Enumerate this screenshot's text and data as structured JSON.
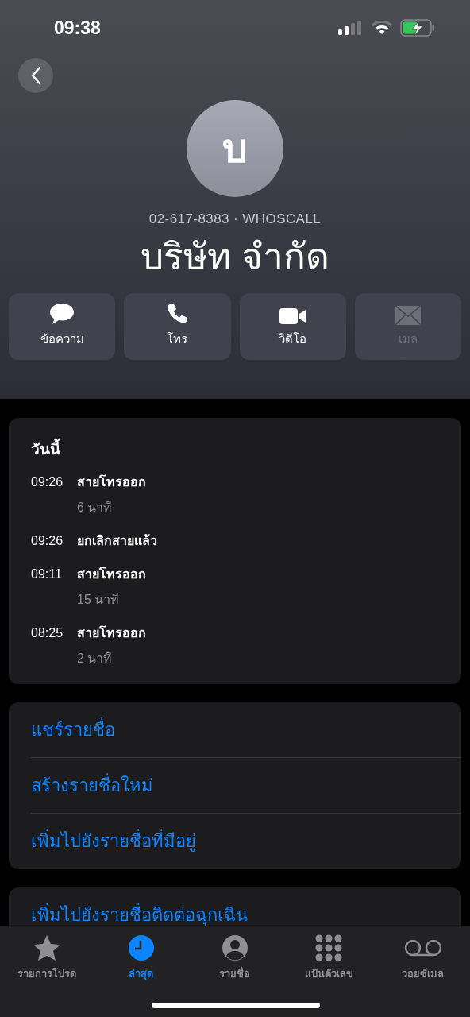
{
  "status_bar": {
    "time": "09:38"
  },
  "contact": {
    "initial": "บ",
    "subtitle": "02-617-8383 · WHOSCALL",
    "name": "บริษัท จำกัด"
  },
  "actions": [
    {
      "kind": "message",
      "label": "ข้อความ",
      "disabled": false
    },
    {
      "kind": "call",
      "label": "โทร",
      "disabled": false
    },
    {
      "kind": "video",
      "label": "วิดีโอ",
      "disabled": false
    },
    {
      "kind": "mail",
      "label": "เมล",
      "disabled": true
    }
  ],
  "call_history": {
    "heading": "วันนี้",
    "calls": [
      {
        "time": "09:26",
        "type": "สายโทรออก",
        "duration": "6 นาที"
      },
      {
        "time": "09:26",
        "type": "ยกเลิกสายแล้ว"
      },
      {
        "time": "09:11",
        "type": "สายโทรออก",
        "duration": "15 นาที"
      },
      {
        "time": "08:25",
        "type": "สายโทรออก",
        "duration": "2 นาที"
      }
    ]
  },
  "options": [
    "แชร์รายชื่อ",
    "สร้างรายชื่อใหม่",
    "เพิ่มไปยังรายชื่อที่มีอยู่"
  ],
  "emergency_option": "เพิ่มไปยังรายชื่อติดต่อฉุกเฉิน",
  "tabs": [
    {
      "kind": "favorites",
      "label": "รายการโปรด",
      "selected": false
    },
    {
      "kind": "recents",
      "label": "ล่าสุด",
      "selected": true
    },
    {
      "kind": "contacts",
      "label": "รายชื่อ",
      "selected": false
    },
    {
      "kind": "keypad",
      "label": "แป้นตัวเลข",
      "selected": false
    },
    {
      "kind": "voicemail",
      "label": "วอยซ์เมล",
      "selected": false
    }
  ]
}
